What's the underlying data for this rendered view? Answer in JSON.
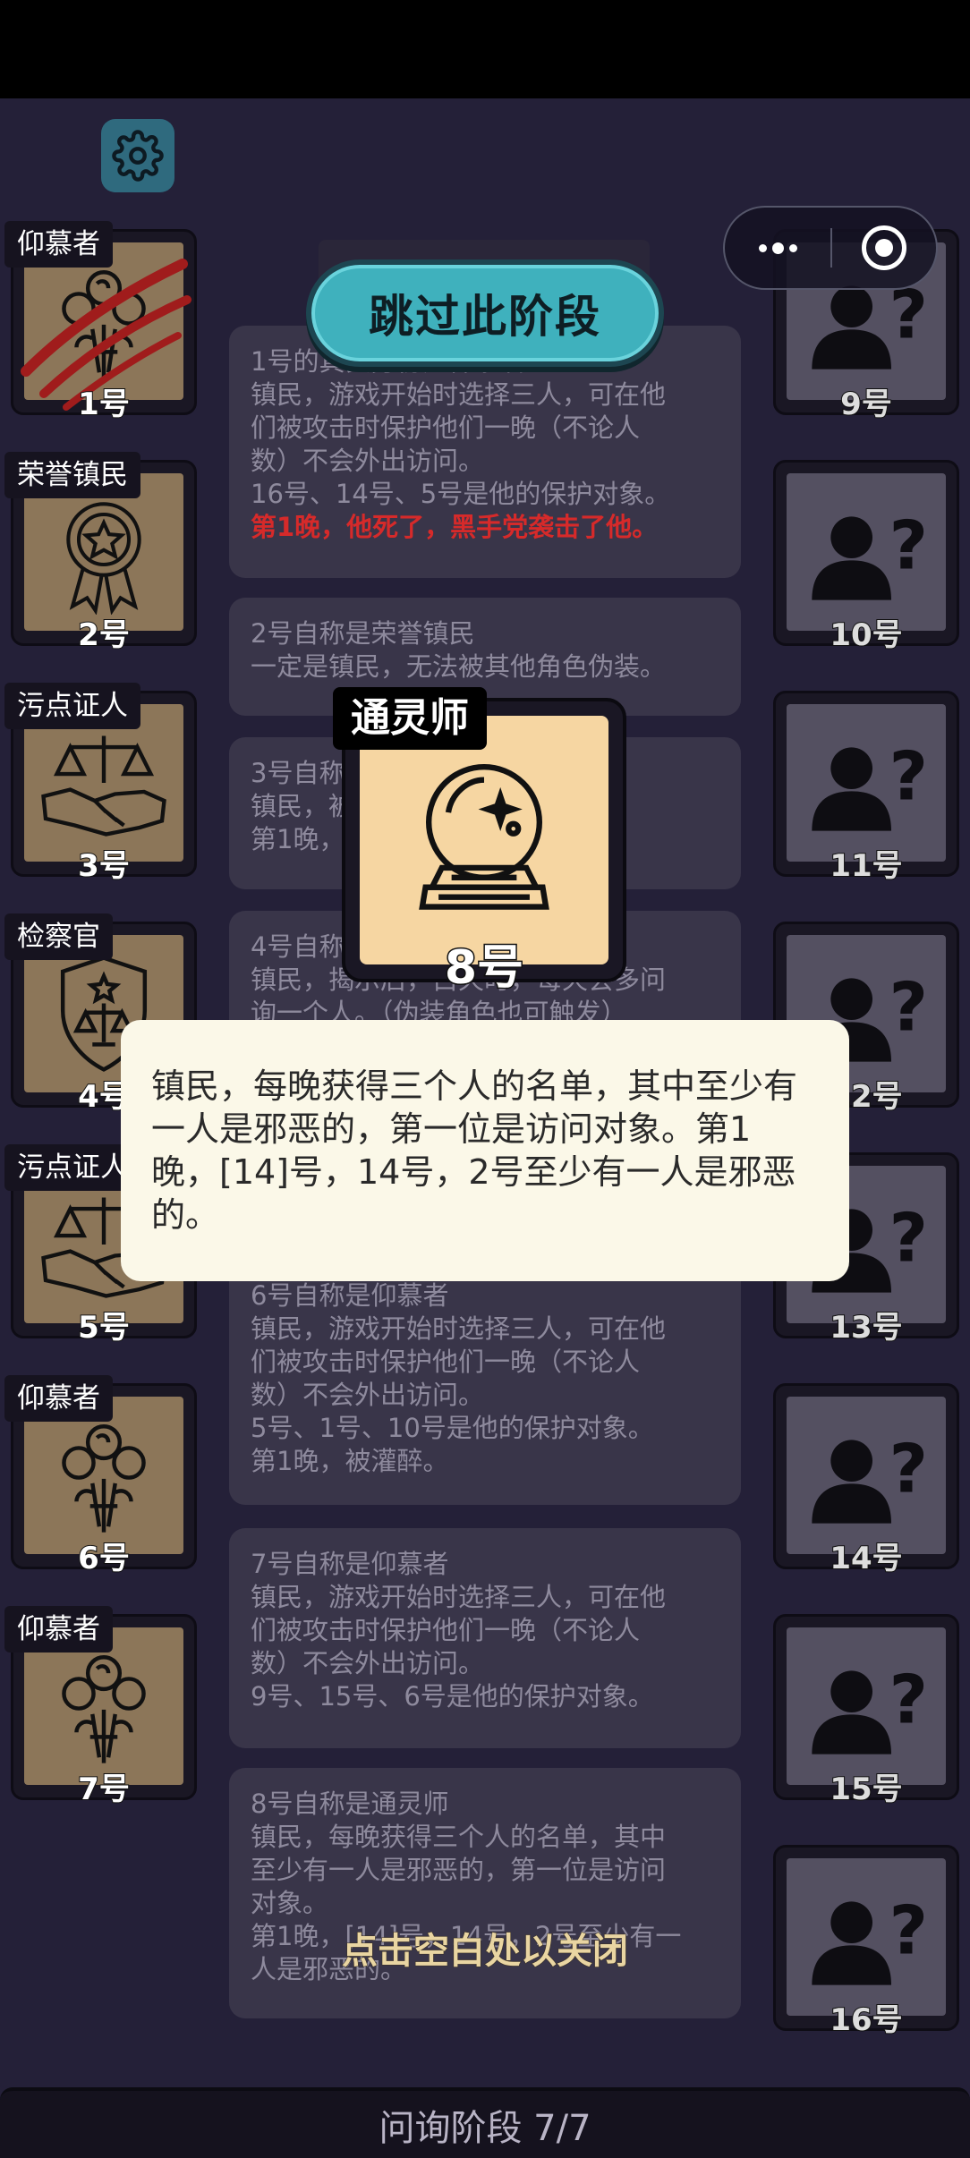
{
  "colors": {
    "background": "#242038",
    "log_card": "#393549",
    "accent_button": "#3fb1bd",
    "alert_red": "#d62a2a",
    "popup_bg": "#fbf8e8",
    "card_known": "#8c7659",
    "card_unknown": "#545061"
  },
  "skip_button": "跳过此阶段",
  "left_players": [
    {
      "role": "仰慕者",
      "num": "1号",
      "icon": "rose-bouquet-icon",
      "dead": true
    },
    {
      "role": "荣誉镇民",
      "num": "2号",
      "icon": "medal-icon",
      "dead": false
    },
    {
      "role": "污点证人",
      "num": "3号",
      "icon": "scales-handshake-icon",
      "dead": false
    },
    {
      "role": "检察官",
      "num": "4号",
      "icon": "badge-scales-icon",
      "dead": false
    },
    {
      "role": "污点证人",
      "num": "5号",
      "icon": "scales-handshake-icon",
      "dead": false
    },
    {
      "role": "仰慕者",
      "num": "6号",
      "icon": "rose-bouquet-icon",
      "dead": false
    },
    {
      "role": "仰慕者",
      "num": "7号",
      "icon": "rose-bouquet-icon",
      "dead": false
    }
  ],
  "right_players": [
    {
      "num": "9号",
      "icon": "unknown-person-icon"
    },
    {
      "num": "10号",
      "icon": "unknown-person-icon"
    },
    {
      "num": "11号",
      "icon": "unknown-person-icon"
    },
    {
      "num": "12号",
      "icon": "unknown-person-icon"
    },
    {
      "num": "13号",
      "icon": "unknown-person-icon"
    },
    {
      "num": "14号",
      "icon": "unknown-person-icon"
    },
    {
      "num": "15号",
      "icon": "unknown-person-icon"
    },
    {
      "num": "16号",
      "icon": "unknown-person-icon"
    }
  ],
  "logs": [
    {
      "lines": [
        "1号的真实身份是仰慕者",
        "镇民，游戏开始时选择三人，可在他",
        "们被攻击时保护他们一晚（不论人",
        "数）不会外出访问。",
        "16号、14号、5号是他的保护对象。"
      ],
      "alert": "第1晚，他死了，黑手党袭击了他。"
    },
    {
      "lines": [
        "2号自称是荣誉镇民",
        "一定是镇民，无法被其他角色伪装。"
      ]
    },
    {
      "lines": [
        "3号自称",
        "镇民，被",
        "第1晚，"
      ]
    },
    {
      "lines": [
        "4号自称",
        "镇民，揭示后，白天时，每天会多问",
        "询一个人。（伪装角色也可触发）"
      ]
    },
    {
      "lines": [
        "6号自称是仰慕者",
        "镇民，游戏开始时选择三人，可在他",
        "们被攻击时保护他们一晚（不论人",
        "数）不会外出访问。",
        "5号、1号、10号是他的保护对象。",
        "第1晚，被灌醉。"
      ]
    },
    {
      "lines": [
        "7号自称是仰慕者",
        "镇民，游戏开始时选择三人，可在他",
        "们被攻击时保护他们一晚（不论人",
        "数）不会外出访问。",
        "9号、15号、6号是他的保护对象。"
      ]
    },
    {
      "lines": [
        "8号自称是通灵师",
        "镇民，每晚获得三个人的名单，其中",
        "至少有一人是邪恶的，第一位是访问",
        "对象。",
        "第1晚，[14]号，14号，2号至少有一",
        "人是邪恶的。"
      ]
    }
  ],
  "featured": {
    "role": "通灵师",
    "num": "8号",
    "icon": "crystal-ball-icon"
  },
  "popup_text": "镇民，每晚获得三个人的名单，其中至少有一人是邪恶的，第一位是访问对象。第1晚，[14]号，14号，2号至少有一人是邪恶的。",
  "close_hint": "点击空白处以关闭",
  "phase": "问询阶段 7/7"
}
